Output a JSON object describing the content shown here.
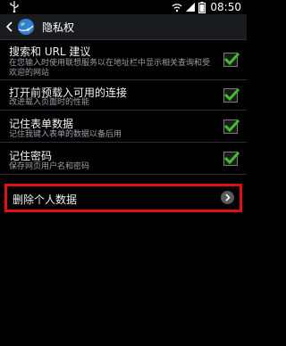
{
  "status_bar": {
    "time": "08:50"
  },
  "action_bar": {
    "title": "隐私权"
  },
  "settings": [
    {
      "title": "搜索和 URL 建议",
      "subtitle": "在您输入时使用联想服务以在地址栏中显示相关查询和受欢迎的网站",
      "checked": true
    },
    {
      "title": "打开前预载入可用的连接",
      "subtitle": "改进载入页面时的性能",
      "checked": true
    },
    {
      "title": "记住表单数据",
      "subtitle": "记住我键入表单的数据以备后用",
      "checked": true
    },
    {
      "title": "记住密码",
      "subtitle": "保存网页用户名和密码",
      "checked": true
    }
  ],
  "delete_item": {
    "label": "删除个人数据"
  },
  "colors": {
    "highlight_border": "#e01010",
    "check_green": "#3fbf2f"
  }
}
